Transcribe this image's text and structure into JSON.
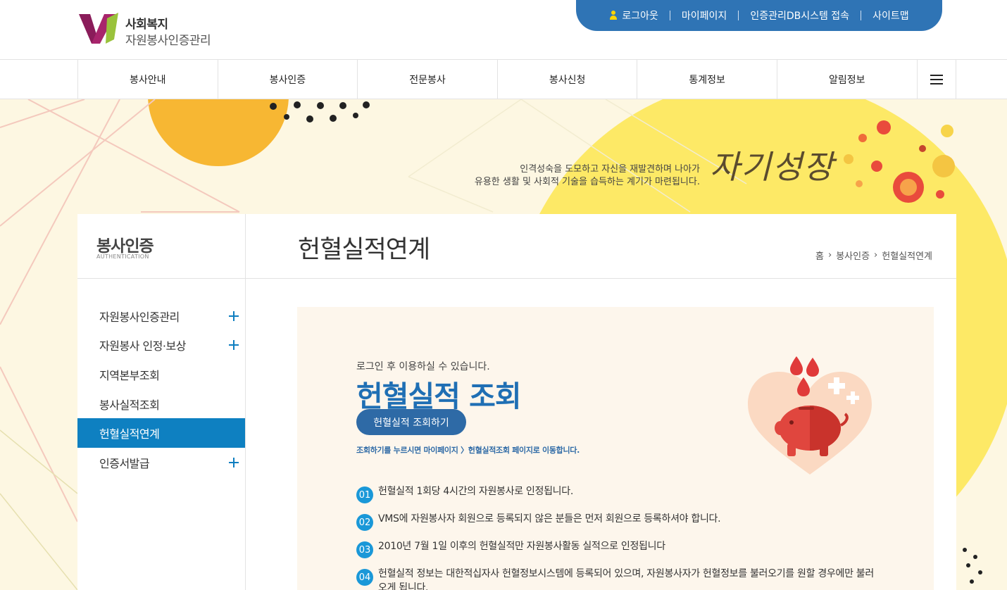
{
  "header": {
    "logo_line1": "사회복지",
    "logo_line2": "자원봉사인증관리",
    "util": {
      "logout": "로그아웃",
      "mypage": "마이페이지",
      "db_system": "인증관리DB시스템 접속",
      "sitemap": "사이트맵"
    }
  },
  "gnb": {
    "items": [
      "봉사안내",
      "봉사인증",
      "전문봉사",
      "봉사신청",
      "통계정보",
      "알림정보"
    ]
  },
  "visual": {
    "copy_line1": "인격성숙을 도모하고 자신을 재발견하며 나아가",
    "copy_line2": "유용한 생활 및 사회적 기술을 습득하는 계기가 마련됩니다.",
    "slogan": "자기성장"
  },
  "lnb": {
    "title": "봉사인증",
    "subtitle": "AUTHENTICATION",
    "items": [
      {
        "label": "자원봉사인증관리",
        "expandable": true
      },
      {
        "label": "자원봉사 인정·보상",
        "expandable": true
      },
      {
        "label": "지역본부조회",
        "expandable": false
      },
      {
        "label": "봉사실적조회",
        "expandable": false
      },
      {
        "label": "헌혈실적연계",
        "expandable": false,
        "active": true
      },
      {
        "label": "인증서발급",
        "expandable": true
      }
    ]
  },
  "page": {
    "title": "헌혈실적연계",
    "breadcrumb": [
      "홈",
      "봉사인증",
      "헌혈실적연계"
    ]
  },
  "content": {
    "login_note": "로그인 후 이용하실 수 있습니다.",
    "big_title": "헌혈실적 조회",
    "button": "헌혈실적 조회하기",
    "hint": "조회하기를 누르시면 마이페이지 〉헌혈실적조회 페이지로 이동합니다.",
    "notes": [
      {
        "num": "01",
        "text": "헌혈실적 1회당 4시간의 자원봉사로 인정됩니다."
      },
      {
        "num": "02",
        "text": "VMS에 자원봉사자 회원으로 등록되지 않은 분들은 먼저 회원으로 등록하셔야 합니다."
      },
      {
        "num": "03",
        "text": "2010년 7월 1일 이후의 헌혈실적만 자원봉사활동 실적으로 인정됩니다"
      },
      {
        "num": "04",
        "text": "헌혈실적 정보는 대한적십자사 헌혈정보시스템에 등록되어 있으며, 자원봉사자가 헌혈정보를 불러오기를 원할 경우에만 불러오게 됩니다."
      }
    ]
  },
  "colors": {
    "primary": "#2f74b5",
    "active_menu": "#0e80c1",
    "title_blue": "#1f6fb4",
    "banner_bg": "#fdf7e2"
  }
}
